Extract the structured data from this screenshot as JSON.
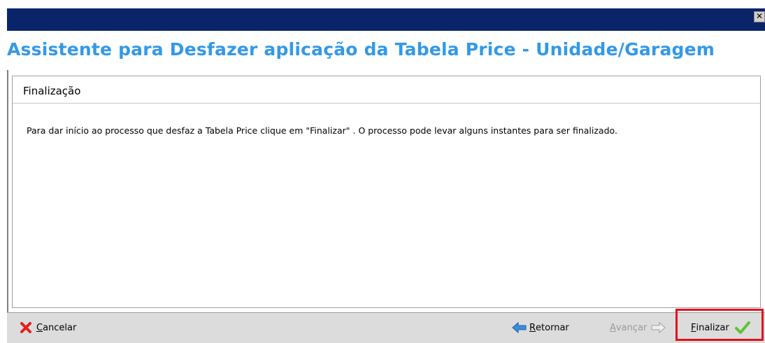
{
  "window": {
    "close_glyph": "✕"
  },
  "header": {
    "title": "Assistente para Desfazer aplicação da Tabela Price - Unidade/Garagem"
  },
  "panel": {
    "title": "Finalização",
    "message": "Para dar início ao processo que desfaz a Tabela Price clique em \"Finalizar\" . O processo pode levar alguns instantes para ser finalizado."
  },
  "footer": {
    "cancel": {
      "first": "C",
      "rest": "ancelar",
      "icon": "red-x-icon"
    },
    "back": {
      "first": "R",
      "rest": "etornar",
      "icon": "blue-left-arrow-icon"
    },
    "next": {
      "first": "A",
      "rest": "vançar",
      "icon": "right-arrow-outline-icon",
      "enabled": false
    },
    "finish": {
      "first": "F",
      "rest": "inalizar",
      "icon": "green-check-icon"
    }
  },
  "colors": {
    "titlebar": "#0a246a",
    "header_title": "#3399e6",
    "footer_bg": "#dcdcdc",
    "highlight_box": "#e0141e"
  }
}
